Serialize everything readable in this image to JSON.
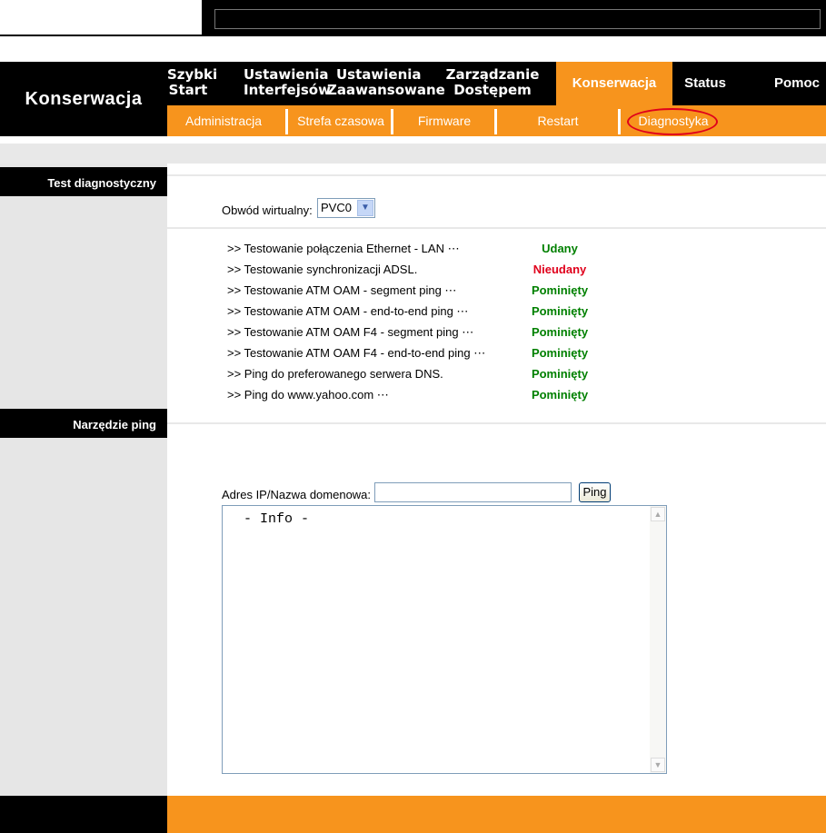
{
  "brand": "Konserwacja",
  "main_nav": [
    {
      "line1": "Szybki",
      "line2": "Start"
    },
    {
      "line1": "Ustawienia",
      "line2": "Interfejsów"
    },
    {
      "line1": "Ustawienia",
      "line2": "Zaawansowane"
    },
    {
      "line1": "Zarządzanie",
      "line2": "Dostępem"
    },
    {
      "label": "Konserwacja"
    },
    {
      "label": "Status"
    },
    {
      "label": "Pomoc"
    }
  ],
  "sub_nav": [
    "Administracja",
    "Strefa czasowa",
    "Firmware",
    "Restart",
    "Diagnostyka"
  ],
  "sections": {
    "diag": "Test diagnostyczny",
    "ping": "Narzędzie ping"
  },
  "vc": {
    "label": "Obwód wirtualny:",
    "value": "PVC0"
  },
  "tests": [
    {
      "name": ">> Testowanie połączenia Ethernet - LAN ⋯",
      "result": "Udany",
      "status": "ok"
    },
    {
      "name": ">> Testowanie synchronizacji ADSL.",
      "result": "Nieudany",
      "status": "fail"
    },
    {
      "name": ">> Testowanie ATM OAM - segment ping ⋯",
      "result": "Pominięty",
      "status": "ok"
    },
    {
      "name": ">> Testowanie ATM OAM - end-to-end ping ⋯",
      "result": "Pominięty",
      "status": "ok"
    },
    {
      "name": ">> Testowanie ATM OAM F4 - segment ping ⋯",
      "result": "Pominięty",
      "status": "ok"
    },
    {
      "name": ">> Testowanie ATM OAM F4 - end-to-end ping ⋯",
      "result": "Pominięty",
      "status": "ok"
    },
    {
      "name": ">> Ping do preferowanego serwera DNS.",
      "result": "Pominięty",
      "status": "ok"
    },
    {
      "name": ">> Ping do www.yahoo.com ⋯",
      "result": "Pominięty",
      "status": "ok"
    }
  ],
  "ping": {
    "label": "Adres IP/Nazwa domenowa:",
    "value": "",
    "button": "Ping",
    "info": " - Info -"
  },
  "colors": {
    "accent": "#f7941d",
    "success": "#008000",
    "failure": "#e0001b",
    "highlight_oval": "#e0001b"
  }
}
